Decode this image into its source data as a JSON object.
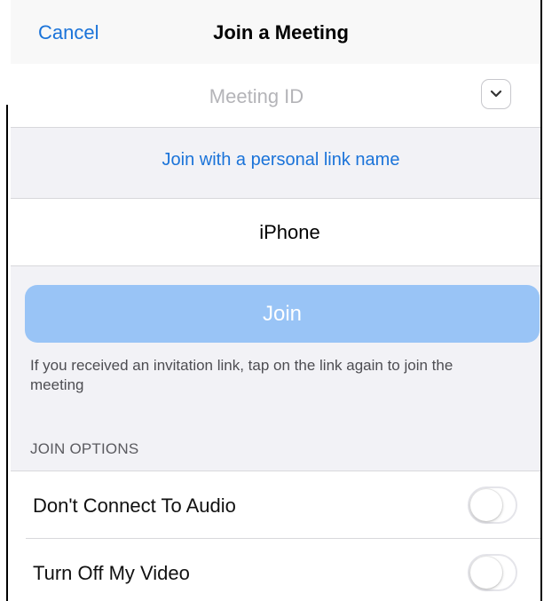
{
  "nav": {
    "cancel_label": "Cancel",
    "title": "Join a Meeting"
  },
  "meeting": {
    "placeholder": "Meeting ID",
    "value": "",
    "dropdown_icon": "chevron-down-icon"
  },
  "personal_link": {
    "label": "Join with a personal link name"
  },
  "name": {
    "value": "iPhone"
  },
  "join": {
    "label": "Join",
    "enabled": false,
    "color": "#99c4f6"
  },
  "help_text": "If you received an invitation link, tap on the link again to join the meeting",
  "join_options": {
    "header": "JOIN OPTIONS",
    "items": [
      {
        "label": "Don't Connect To Audio",
        "on": false
      },
      {
        "label": "Turn Off My Video",
        "on": false
      }
    ]
  },
  "colors": {
    "accent": "#1a73d9",
    "background": "#f2f2f6"
  }
}
